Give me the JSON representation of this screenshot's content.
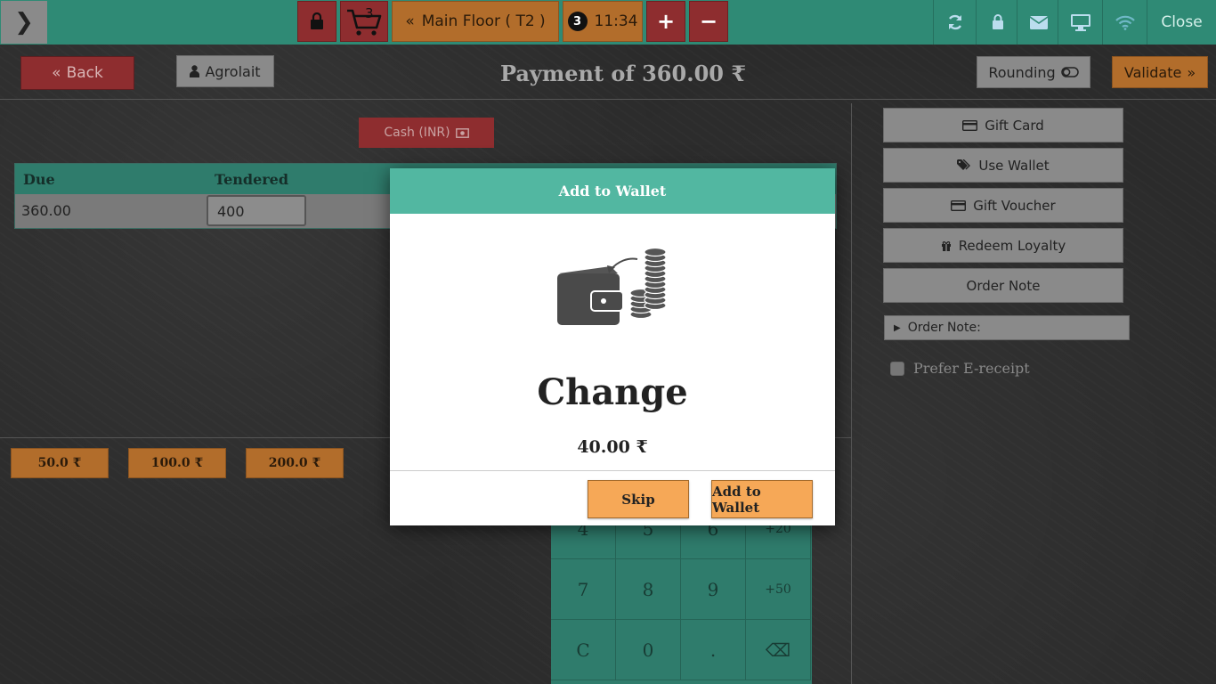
{
  "topbar": {
    "cart_count": "3",
    "floor_label": "Main Floor ( T2 )",
    "orders_badge": "3",
    "time": "11:34",
    "plus": "+",
    "minus": "−",
    "close_label": "Close"
  },
  "header": {
    "back_label": "Back",
    "customer_label": "Agrolait",
    "payment_title": "Payment of 360.00 ₹",
    "rounding_label": "Rounding",
    "validate_label": "Validate"
  },
  "payment": {
    "method_label": "Cash (INR)",
    "columns": {
      "due": "Due",
      "tendered": "Tendered"
    },
    "due_value": "360.00",
    "tendered_value": "400"
  },
  "quick_amounts": [
    "50.0 ₹",
    "100.0 ₹",
    "200.0 ₹"
  ],
  "numpad": {
    "keys": [
      "4",
      "5",
      "6",
      "+20",
      "7",
      "8",
      "9",
      "+50",
      "C",
      "0",
      ".",
      "⌫"
    ]
  },
  "right_panel": {
    "buttons": [
      "Gift Card",
      "Use Wallet",
      "Gift Voucher",
      "Redeem Loyalty",
      "Order Note"
    ],
    "order_note_label": "Order Note:",
    "ereceipt_label": "Prefer E-receipt"
  },
  "modal": {
    "title": "Add to Wallet",
    "heading": "Change",
    "amount": "40.00 ₹",
    "skip_label": "Skip",
    "add_label": "Add to Wallet"
  },
  "colors": {
    "teal": "#2f8a75",
    "modal_header": "#52b7a1",
    "orange": "#f6a857",
    "red": "#8e2d2f"
  }
}
